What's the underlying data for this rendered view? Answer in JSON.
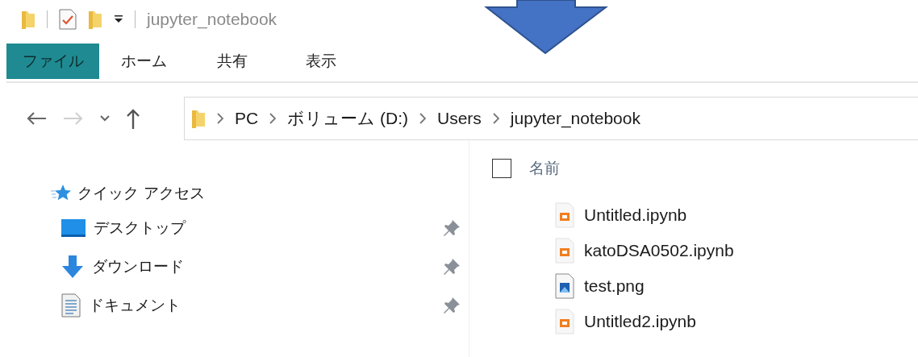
{
  "window": {
    "title": "jupyter_notebook"
  },
  "ribbon_tabs": [
    {
      "label": "ファイル",
      "selected": true
    },
    {
      "label": "ホーム",
      "selected": false
    },
    {
      "label": "共有",
      "selected": false
    },
    {
      "label": "表示",
      "selected": false
    }
  ],
  "navigation": {
    "forward_disabled": true
  },
  "address_bar": {
    "path": [
      "PC",
      "ボリューム (D:)",
      "Users",
      "jupyter_notebook"
    ]
  },
  "navigation_pane": {
    "header": "クイック アクセス",
    "items": [
      {
        "label": "デスクトップ",
        "kind": "desktop",
        "pinned": true
      },
      {
        "label": "ダウンロード",
        "kind": "download",
        "pinned": true
      },
      {
        "label": "ドキュメント",
        "kind": "document",
        "pinned": true
      }
    ]
  },
  "file_list": {
    "column_header": "名前",
    "select_all_checked": false,
    "files": [
      {
        "name": "Untitled.ipynb",
        "kind": "notebook"
      },
      {
        "name": "katoDSA0502.ipynb",
        "kind": "notebook"
      },
      {
        "name": "test.png",
        "kind": "image"
      },
      {
        "name": "Untitled2.ipynb",
        "kind": "notebook"
      }
    ]
  }
}
